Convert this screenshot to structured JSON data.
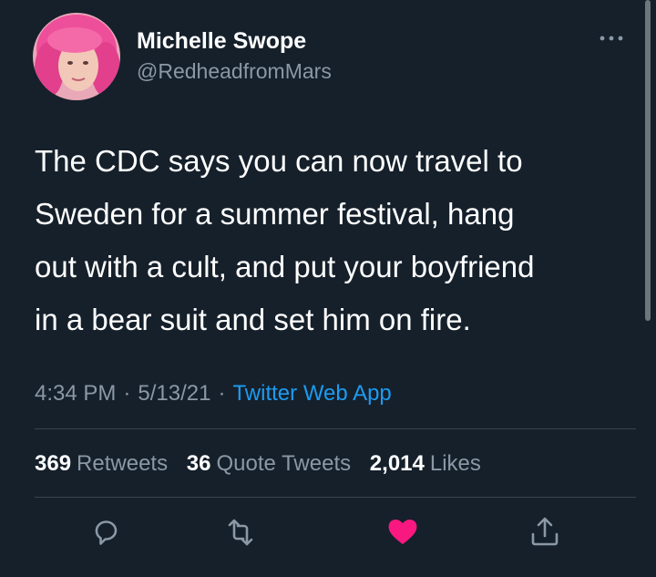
{
  "author": {
    "name": "Michelle Swope",
    "handle": "@RedheadfromMars"
  },
  "more_icon": "more-horizontal-icon",
  "tweet": {
    "lines": [
      "The CDC says you can now travel to",
      "Sweden for a summer festival, hang",
      "out with a cult, and put your boyfriend",
      "in a bear suit and set him on fire."
    ]
  },
  "meta": {
    "time": "4:34 PM",
    "separator": "·",
    "date": "5/13/21",
    "source": "Twitter Web App"
  },
  "stats": {
    "retweets_count": "369",
    "retweets_label": "Retweets",
    "quotes_count": "36",
    "quotes_label": "Quote Tweets",
    "likes_count": "2,014",
    "likes_label": "Likes"
  },
  "actions": [
    {
      "icon": "reply-icon"
    },
    {
      "icon": "retweet-icon"
    },
    {
      "icon": "heart-icon",
      "active": true,
      "color": "#f91880"
    },
    {
      "icon": "share-icon"
    }
  ],
  "colors": {
    "background": "#15202b",
    "secondary_text": "#8b98a5",
    "link": "#1d9bf0",
    "like": "#f91880"
  }
}
